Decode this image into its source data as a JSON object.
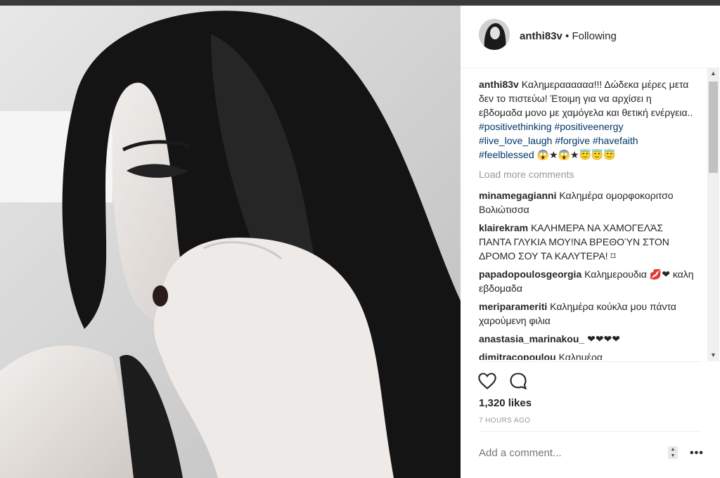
{
  "post": {
    "username": "anthi83v",
    "follow_status": "• Following",
    "caption": {
      "username": "anthi83v",
      "text": "Καλημεραααααα!!! Δώδεκα μέρες μετα δεν το πιστεύω! Έτοιμη για να αρχίσει η εβδομαδα μονο με χαμόγελα και θετική ενέργεια..",
      "hashtags": [
        "#positivethinking",
        "#positiveenergy",
        "#live_love_laugh",
        "#forgive",
        "#havefaith",
        "#feelblessed"
      ],
      "emoji": "😱★😱★😇😇😇"
    },
    "load_more": "Load more comments",
    "comments": [
      {
        "user": "minamegagianni",
        "text": "Καλημέρα ομορφοκοριτσο Βολιώτισσα"
      },
      {
        "user": "klairekram",
        "text": "ΚΑΛΗΜΕΡΑ ΝΑ ΧΑΜΟΓΕΛΆΣ ΠΑΝΤΑ ΓΛΥΚΙΑ ΜΟΥ!ΝΑ ΒΡΕΘΟΎΝ ΣΤΟΝ ΔΡΟΜΟ ΣΟΥ ΤΑ ΚΑΛΥΤΕΡΑ! ⌑"
      },
      {
        "user": "papadopoulosgeorgia",
        "text": "Καλημερουδια 💋❤ καλη εβδομαδα"
      },
      {
        "user": "meriparameriti",
        "text": "Καλημέρα κούκλα μου πάντα χαρούμενη φιλια"
      },
      {
        "user": "anastasia_marinakou_",
        "text": "❤❤❤❤"
      },
      {
        "user": "dimitracopoulou",
        "text": "Καλημέρα"
      }
    ],
    "likes": "1,320 likes",
    "time": "7 HOURS AGO",
    "add_comment_placeholder": "Add a comment...",
    "more_label": "•••"
  },
  "icons": {
    "like": "heart-icon",
    "comment": "comment-bubble-icon",
    "scroll_up": "arrow-up-icon",
    "scroll_down": "arrow-down-icon"
  },
  "colors": {
    "link": "#003569",
    "muted": "#999999",
    "text": "#262626"
  }
}
